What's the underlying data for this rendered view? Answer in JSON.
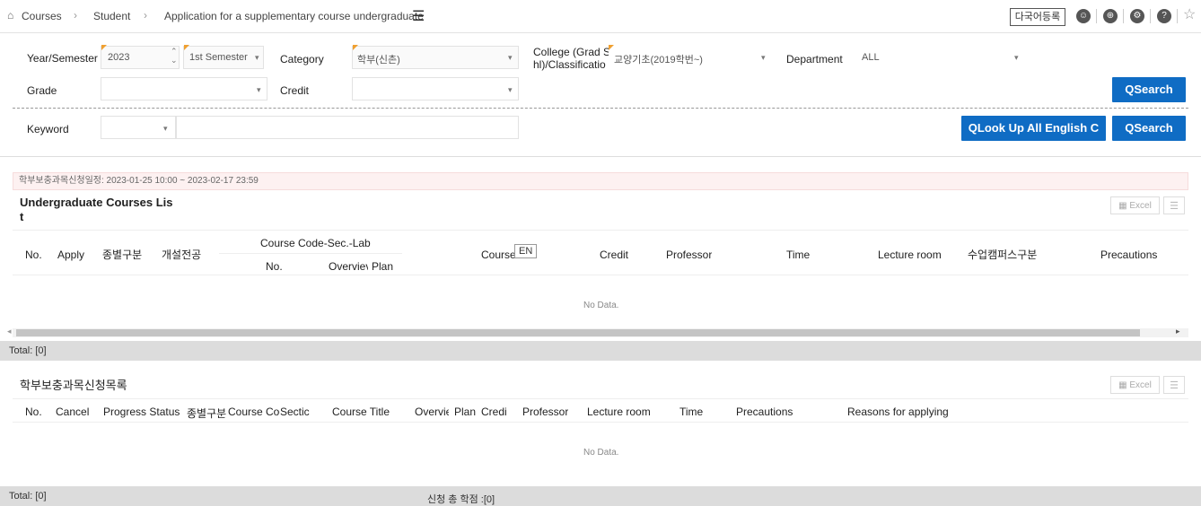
{
  "breadcrumb": {
    "home": "Courses",
    "student": "Student",
    "page": "Application for a supplementary course undergraduate"
  },
  "topbar": {
    "lang_button": "다국어등록"
  },
  "filters": {
    "year_label": "Year/Semester",
    "year_value": "2023",
    "semester_value": "1st Semester",
    "category_label": "Category",
    "category_value": "학부(신촌)",
    "college_label_1": "College (Grad Sc",
    "college_label_2": "hl)/Classificatio",
    "college_value": "교양기초(2019학번~)",
    "department_label": "Department",
    "department_value": "ALL",
    "grade_label": "Grade",
    "credit_label": "Credit",
    "keyword_label": "Keyword",
    "search_label": "Search",
    "lookup_label": "Look Up All English C"
  },
  "schedule_notice": "학부보충과목신청일정: 2023-01-25 10:00 ~ 2023-02-17 23:59",
  "courses": {
    "title_1": "Undergraduate Courses Lis",
    "title_2": "t",
    "excel": "Excel",
    "headers": {
      "no": "No.",
      "apply": "Apply",
      "type": "종별구분",
      "major": "개설전공",
      "code_group": "Course Code-Sec.-Lab",
      "code_no": "No.",
      "overview": "Overviev",
      "plan": "Plan",
      "course": "Course",
      "en": "EN",
      "credit": "Credit",
      "professor": "Professor",
      "time": "Time",
      "room": "Lecture room",
      "campus": "수업캠퍼스구분",
      "precautions": "Precautions"
    },
    "no_data": "No Data.",
    "total": "Total: [0]"
  },
  "applied": {
    "title": "학부보충과목신청목록",
    "excel": "Excel",
    "headers": {
      "no": "No.",
      "cancel": "Cancel",
      "status": "Progress Status",
      "type": "종별구분",
      "code": "Course Cod",
      "section": "Sectic",
      "course_title": "Course Title",
      "overview": "Overvie",
      "plan": "Plan",
      "credit": "Credi",
      "professor": "Professor",
      "room": "Lecture room",
      "time": "Time",
      "precautions": "Precautions",
      "reasons": "Reasons for applying"
    },
    "no_data": "No Data.",
    "total": "Total: [0]",
    "total_credit": "신청 총 학점 :[0]"
  }
}
